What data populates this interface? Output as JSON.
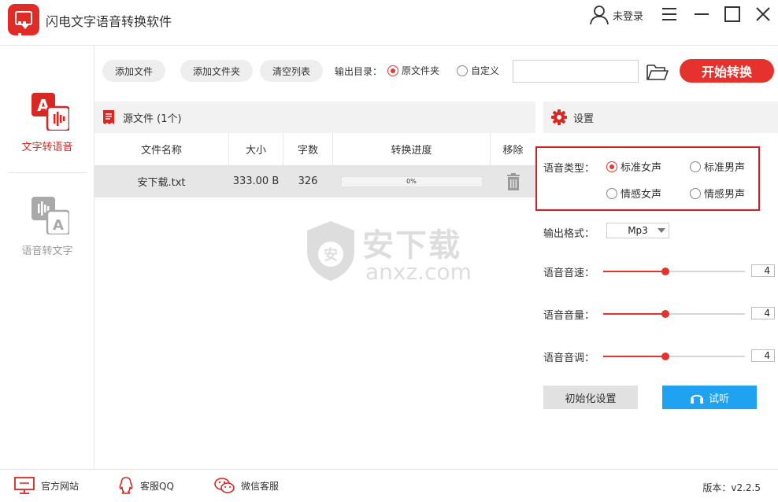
{
  "window": {
    "title": "闪电文字语音转换软件",
    "user_label": "未登录"
  },
  "sidebar": {
    "items": [
      {
        "label": "文字转语音",
        "active": true
      },
      {
        "label": "语音转文字",
        "active": false
      }
    ]
  },
  "toolbar": {
    "add_file": "添加文件",
    "add_folder": "添加文件夹",
    "clear_list": "清空列表",
    "output_dir_label": "输出目录：",
    "output_options": [
      {
        "label": "原文件夹",
        "selected": true
      },
      {
        "label": "自定义",
        "selected": false
      }
    ],
    "output_path_value": "",
    "start_button": "开始转换"
  },
  "source": {
    "title": "源文件 (1个)",
    "columns": [
      "文件名称",
      "大小",
      "字数",
      "转换进度",
      "移除"
    ],
    "rows": [
      {
        "name": "安下载.txt",
        "size": "333.00 B",
        "words": "326",
        "progress_text": "0%",
        "progress": 0
      }
    ]
  },
  "watermark": {
    "text_cn": "安下载",
    "text_en": "anxz.com",
    "badge_char": "安"
  },
  "settings": {
    "title": "设置",
    "voice_type_label": "语音类型：",
    "voice_options": [
      {
        "label": "标准女声",
        "selected": true
      },
      {
        "label": "标准男声",
        "selected": false
      },
      {
        "label": "情感女声",
        "selected": false
      },
      {
        "label": "情感男声",
        "selected": false
      }
    ],
    "format_label": "输出格式：",
    "format_value": "Mp3",
    "speed_label": "语音音速：",
    "speed_value": "4",
    "speed_fraction": 0.44,
    "volume_label": "语音音量：",
    "volume_value": "4",
    "volume_fraction": 0.44,
    "pitch_label": "语音音调：",
    "pitch_value": "4",
    "pitch_fraction": 0.44,
    "reset_button": "初始化设置",
    "listen_button": "试听"
  },
  "footer": {
    "website": "官方网站",
    "qq": "客服QQ",
    "wechat": "微信客服",
    "version": "版本：v2.2.5"
  },
  "colors": {
    "accent_red": "#e5322d",
    "listen_blue": "#1fa3f1"
  }
}
